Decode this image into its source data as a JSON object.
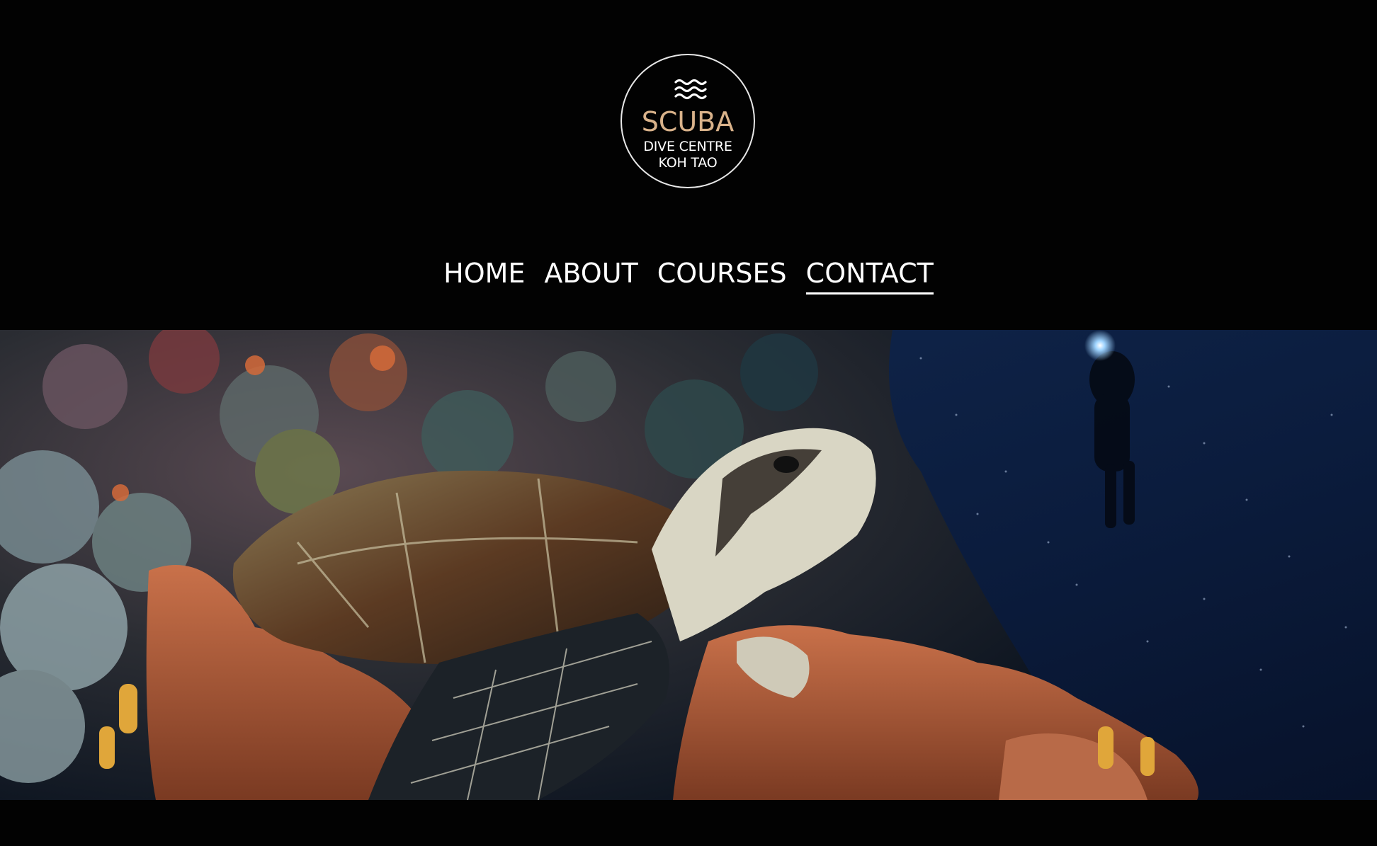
{
  "logo": {
    "brand": "SCUBA",
    "line1": "DIVE CENTRE",
    "line2": "KOH TAO",
    "brand_color": "#d9b28a",
    "icon": "waves-icon"
  },
  "nav": {
    "items": [
      {
        "label": "HOME",
        "active": false
      },
      {
        "label": "ABOUT",
        "active": false
      },
      {
        "label": "COURSES",
        "active": false
      },
      {
        "label": "CONTACT",
        "active": true
      }
    ]
  },
  "hero": {
    "subject": "sea-turtle-reef-photo"
  },
  "colors": {
    "background": "#020202",
    "text": "#ffffff",
    "accent": "#d9b28a"
  }
}
